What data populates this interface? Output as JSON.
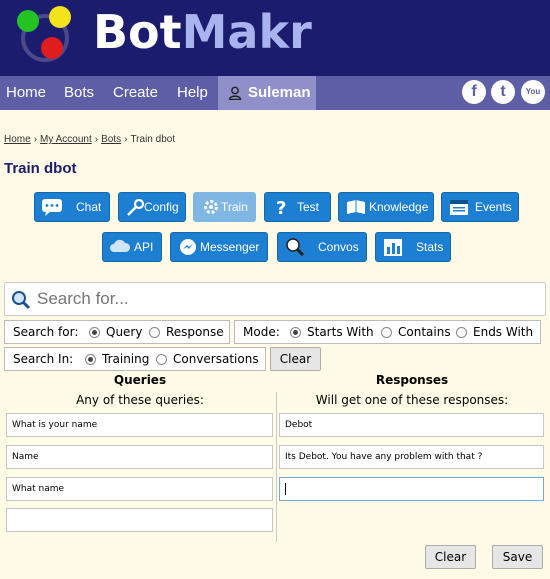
{
  "brand": {
    "part1": "Bot",
    "part2": "Makr"
  },
  "nav": {
    "items": [
      "Home",
      "Bots",
      "Create",
      "Help"
    ],
    "user": "Suleman",
    "social": [
      {
        "name": "facebook-icon",
        "glyph": "f"
      },
      {
        "name": "twitter-icon",
        "glyph": "t"
      },
      {
        "name": "youtube-icon",
        "glyph": "You"
      }
    ]
  },
  "breadcrumb": {
    "home": "Home",
    "account": "My Account",
    "bots": "Bots",
    "current": "Train dbot",
    "sep": "›"
  },
  "page_title": "Train dbot",
  "buttons": {
    "chat": "Chat",
    "config": "Config",
    "train": "Train",
    "test": "Test",
    "knowledge": "Knowledge",
    "events": "Events",
    "api": "API",
    "messenger": "Messenger",
    "convos": "Convos",
    "stats": "Stats"
  },
  "search": {
    "placeholder": "Search for..."
  },
  "search_for": {
    "label": "Search for:",
    "opt1": "Query",
    "opt2": "Response",
    "selected": "Query"
  },
  "mode": {
    "label": "Mode:",
    "opt1": "Starts With",
    "opt2": "Contains",
    "opt3": "Ends With",
    "selected": "Starts With"
  },
  "search_in": {
    "label": "Search In:",
    "opt1": "Training",
    "opt2": "Conversations",
    "selected": "Training"
  },
  "clear_label": "Clear",
  "queries": {
    "heading": "Queries",
    "sub": "Any of these queries:",
    "values": [
      "What is your name",
      "Name",
      "What name",
      ""
    ]
  },
  "responses": {
    "heading": "Responses",
    "sub": "Will get one of these responses:",
    "values": [
      "Debot",
      "Its Debot. You have any problem with that ?",
      ""
    ]
  },
  "footer": {
    "clear": "Clear",
    "save": "Save"
  },
  "colors": {
    "header": "#1c1c6e",
    "nav": "#5d5ea6",
    "accent_button": "#1d7fd1",
    "background": "#fffbe6"
  }
}
